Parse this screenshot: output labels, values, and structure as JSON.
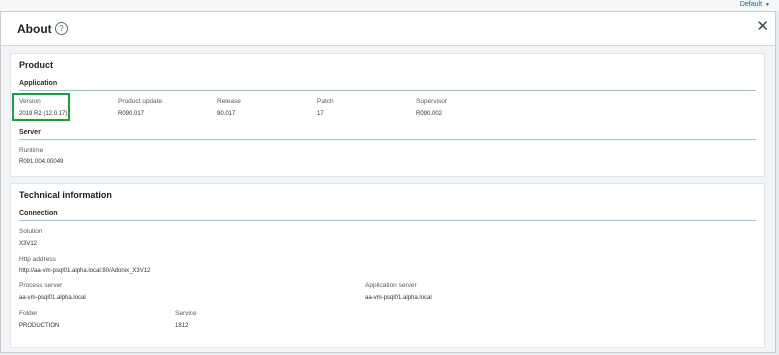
{
  "top_bar": {
    "default_label": "Default"
  },
  "header": {
    "title": "About",
    "help_icon": "question-circle-icon",
    "close_icon": "close-icon"
  },
  "product": {
    "title": "Product",
    "application": {
      "title": "Application",
      "fields": [
        {
          "label": "Version",
          "value": "2019 R2 (12.0.17)"
        },
        {
          "label": "Product update",
          "value": "R090.017"
        },
        {
          "label": "Release",
          "value": "90.017"
        },
        {
          "label": "Patch",
          "value": "17"
        },
        {
          "label": "Supervisor",
          "value": "R090.002"
        }
      ]
    },
    "server": {
      "title": "Server",
      "fields": [
        {
          "label": "Runtime",
          "value": "R091.004.00049"
        }
      ]
    }
  },
  "technical": {
    "title": "Technical information",
    "connection": {
      "title": "Connection",
      "solution": {
        "label": "Solution",
        "value": "X3V12"
      },
      "http_address": {
        "label": "Http address",
        "value": "http://aa-vm-psql01.alpha.local:80/Adonix_X3V12"
      },
      "process_server": {
        "label": "Process server",
        "value": "aa-vm-psql01.alpha.local"
      },
      "application_server": {
        "label": "Application server",
        "value": "aa-vm-psql01.alpha.local"
      },
      "folder": {
        "label": "Folder",
        "value": "PRODUCTION"
      },
      "service": {
        "label": "Service",
        "value": "1812"
      }
    }
  },
  "colors": {
    "accent_rule": "#9dbfd6",
    "highlight": "#1e9e3c",
    "link": "#2d5f9a"
  }
}
